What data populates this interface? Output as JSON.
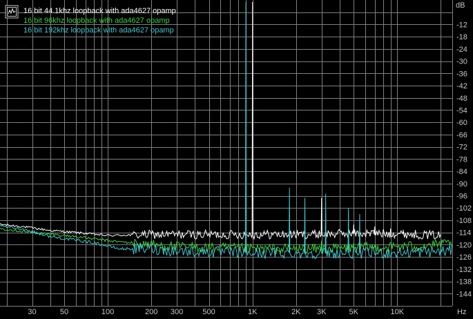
{
  "chart_data": {
    "type": "line",
    "title": "",
    "xlabel": "Hz",
    "ylabel": "dB",
    "x_scale": "log",
    "xlim": [
      18,
      24000
    ],
    "ylim": [
      -150,
      0
    ],
    "x_ticks": [
      {
        "value": 30,
        "label": "30"
      },
      {
        "value": 50,
        "label": "50"
      },
      {
        "value": 100,
        "label": "100"
      },
      {
        "value": 200,
        "label": "200"
      },
      {
        "value": 300,
        "label": "300"
      },
      {
        "value": 500,
        "label": "500"
      },
      {
        "value": 1000,
        "label": "1K"
      },
      {
        "value": 2000,
        "label": "2K"
      },
      {
        "value": 3000,
        "label": "3K"
      },
      {
        "value": 5000,
        "label": "5K"
      },
      {
        "value": 10000,
        "label": "10K"
      }
    ],
    "y_ticks": [
      -12,
      -18,
      -24,
      -30,
      -36,
      -42,
      -48,
      -54,
      -60,
      -66,
      -72,
      -78,
      -84,
      -90,
      -96,
      -102,
      -108,
      -114,
      -120,
      -126,
      -132,
      -138,
      -144
    ],
    "grid": true,
    "legend_position": "top-left",
    "background": "#000000",
    "grid_color": "#808080",
    "series": [
      {
        "name": "16 bit 44.1khz loopback with ada4627 opamp",
        "color": "#ffffff",
        "baseline": [
          [
            18,
            -110
          ],
          [
            25,
            -111
          ],
          [
            40,
            -113
          ],
          [
            60,
            -114
          ],
          [
            100,
            -115.5
          ],
          [
            200,
            -115
          ],
          [
            300,
            -115
          ],
          [
            600,
            -115
          ],
          [
            1000,
            -115
          ],
          [
            2000,
            -115
          ],
          [
            5000,
            -114.5
          ],
          [
            10000,
            -114.5
          ],
          [
            20000,
            -115.5
          ]
        ],
        "noise": 2.2,
        "peaks": [
          [
            1000,
            -1
          ],
          [
            3000,
            -97
          ],
          [
            5000,
            -110
          ],
          [
            7000,
            -111
          ],
          [
            9000,
            -112
          ],
          [
            11000,
            -113
          ]
        ],
        "max_freq": 20000
      },
      {
        "name": "16 bit 96khz loopback with ada4627 opamp",
        "color": "#3bd23b",
        "baseline": [
          [
            18,
            -112
          ],
          [
            30,
            -114
          ],
          [
            60,
            -116
          ],
          [
            100,
            -118
          ],
          [
            200,
            -120
          ],
          [
            300,
            -121
          ],
          [
            1000,
            -122
          ],
          [
            3000,
            -122
          ],
          [
            10000,
            -121
          ],
          [
            20000,
            -120
          ],
          [
            24000,
            -119
          ]
        ],
        "noise": 2.5,
        "peaks": [
          [
            3000,
            -118
          ],
          [
            5000,
            -119
          ],
          [
            7000,
            -120
          ]
        ],
        "max_freq": 24000
      },
      {
        "name": "16 bit 192khz loopback with ada4627 opamp",
        "color": "#40c8d0",
        "baseline": [
          [
            18,
            -111
          ],
          [
            25,
            -112
          ],
          [
            40,
            -116
          ],
          [
            80,
            -119
          ],
          [
            120,
            -122
          ],
          [
            200,
            -122
          ],
          [
            300,
            -123
          ],
          [
            500,
            -123.5
          ],
          [
            1000,
            -124
          ],
          [
            3000,
            -124
          ],
          [
            10000,
            -124
          ],
          [
            24000,
            -123
          ]
        ],
        "noise": 2.8,
        "peaks": [
          [
            900,
            -1
          ],
          [
            1800,
            -92
          ],
          [
            2300,
            -97
          ],
          [
            3200,
            -95
          ],
          [
            4600,
            -102
          ],
          [
            5500,
            -105
          ]
        ],
        "max_freq": 24000
      }
    ]
  }
}
